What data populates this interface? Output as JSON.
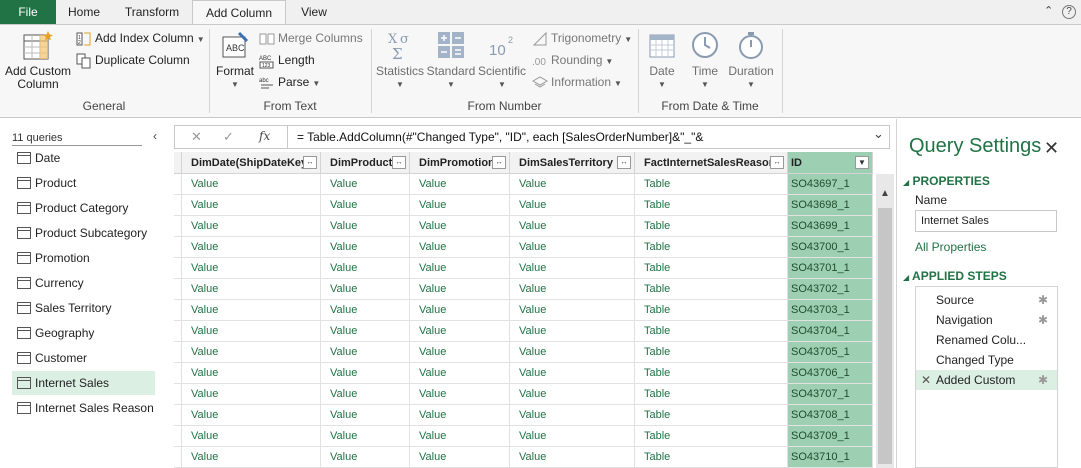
{
  "ribbon_tabs": {
    "file": "File",
    "home": "Home",
    "transform": "Transform",
    "add_column": "Add Column",
    "view": "View"
  },
  "window_controls": {
    "collapse": "⌃",
    "help": "?"
  },
  "general": {
    "label": "General",
    "add_custom_column": "Add Custom\nColumn",
    "add_custom_1": "Add Custom",
    "add_custom_2": "Column",
    "add_index_column": "Add Index Column",
    "duplicate_column": "Duplicate Column"
  },
  "from_text": {
    "label": "From Text",
    "format": "Format",
    "merge_columns": "Merge Columns",
    "length": "Length",
    "parse": "Parse"
  },
  "from_number": {
    "label": "From Number",
    "statistics": "Statistics",
    "standard": "Standard",
    "scientific": "Scientific",
    "trigonometry": "Trigonometry",
    "rounding": "Rounding",
    "information": "Information"
  },
  "from_datetime": {
    "label": "From Date & Time",
    "date": "Date",
    "time": "Time",
    "duration": "Duration"
  },
  "queries": {
    "count_label": "11 queries",
    "collapse_glyph": "‹",
    "items": [
      "Date",
      "Product",
      "Product Category",
      "Product Subcategory",
      "Promotion",
      "Currency",
      "Sales Territory",
      "Geography",
      "Customer",
      "Internet Sales",
      "Internet Sales Reason"
    ],
    "selected": "Internet Sales"
  },
  "formula_bar": {
    "cancel": "✕",
    "confirm": "✓",
    "fx": "fx",
    "formula": "= Table.AddColumn(#\"Changed Type\", \"ID\", each [SalesOrderNumber]&\"_\"&",
    "expand": "⌄"
  },
  "grid": {
    "columns": [
      {
        "name": "DimDate(ShipDateKey)",
        "kind": "value"
      },
      {
        "name": "DimProduct",
        "kind": "value"
      },
      {
        "name": "DimPromotion",
        "kind": "value"
      },
      {
        "name": "DimSalesTerritory",
        "kind": "value"
      },
      {
        "name": "FactInternetSalesReason",
        "kind": "table"
      },
      {
        "name": "ID",
        "kind": "id"
      }
    ],
    "cell_value": "Value",
    "cell_table": "Table",
    "expand_glyph": "↔",
    "filter_glyph": "▼",
    "ids": [
      "SO43697_1",
      "SO43698_1",
      "SO43699_1",
      "SO43700_1",
      "SO43701_1",
      "SO43702_1",
      "SO43703_1",
      "SO43704_1",
      "SO43705_1",
      "SO43706_1",
      "SO43707_1",
      "SO43708_1",
      "SO43709_1",
      "SO43710_1"
    ]
  },
  "settings": {
    "title": "Query Settings",
    "close": "✕",
    "properties_header": "PROPERTIES",
    "name_label": "Name",
    "name_value": "Internet Sales",
    "all_properties": "All Properties",
    "applied_steps_header": "APPLIED STEPS",
    "steps": [
      {
        "label": "Source",
        "gear": true
      },
      {
        "label": "Navigation",
        "gear": true
      },
      {
        "label": "Renamed Colu...",
        "gear": false
      },
      {
        "label": "Changed Type",
        "gear": false
      },
      {
        "label": "Added Custom",
        "gear": true
      }
    ],
    "selected_step": "Added Custom",
    "expand_triangle": "◢"
  },
  "colors": {
    "accent": "#217346",
    "selected_bg": "#dbefe3",
    "id_column": "#9dcfb2",
    "value_text": "#217346"
  }
}
